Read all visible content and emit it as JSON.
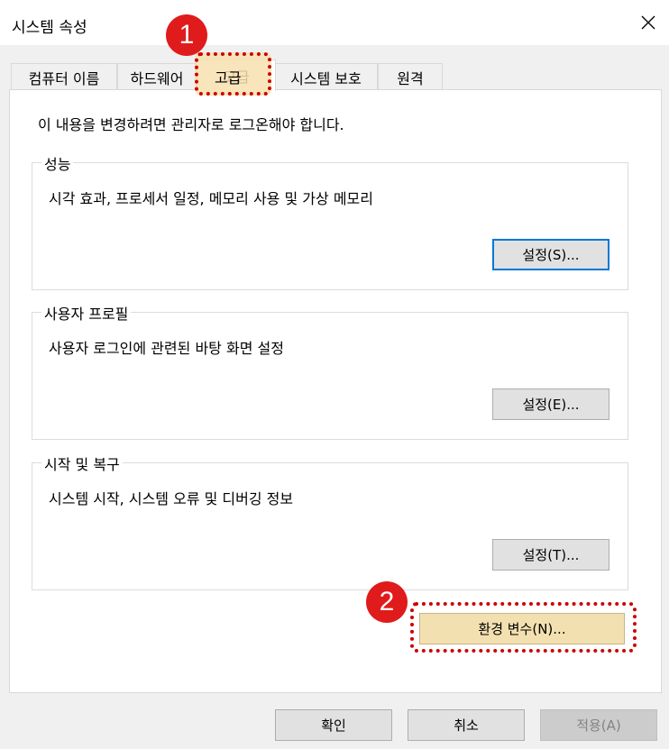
{
  "window": {
    "title": "시스템 속성",
    "close_icon": "close-icon"
  },
  "tabs": [
    {
      "label": "컴퓨터 이름"
    },
    {
      "label": "하드웨어"
    },
    {
      "label": "고급",
      "active": true
    },
    {
      "label": "시스템 보호"
    },
    {
      "label": "원격"
    }
  ],
  "notice": "이 내용을 변경하려면 관리자로 로그온해야 합니다.",
  "groups": [
    {
      "title": "성능",
      "description": "시각 효과, 프로세서 일정, 메모리 사용 및 가상 메모리",
      "button": "설정(S)..."
    },
    {
      "title": "사용자 프로필",
      "description": "사용자 로그인에 관련된 바탕 화면 설정",
      "button": "설정(E)..."
    },
    {
      "title": "시작 및 복구",
      "description": "시스템 시작, 시스템 오류 및 디버깅 정보",
      "button": "설정(T)..."
    }
  ],
  "env_button": "환경 변수(N)...",
  "footer": {
    "ok": "확인",
    "cancel": "취소",
    "apply": "적용(A)"
  },
  "annotations": {
    "marker1": "1",
    "marker2": "2",
    "highlight_color": "#cc0000",
    "marker_color": "#e01b1b"
  }
}
